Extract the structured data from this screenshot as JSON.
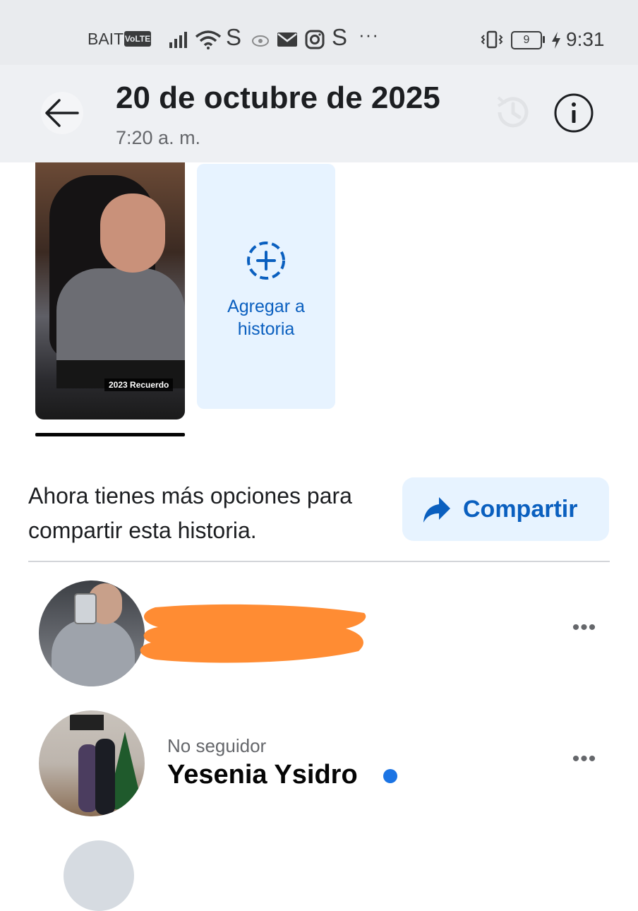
{
  "status_bar": {
    "carrier": "BAIT",
    "volte": "VoLTE",
    "app_icon_s": "S",
    "more": "···",
    "battery_level": "9",
    "time": "9:31",
    "icons": [
      "signal-icon",
      "wifi-icon",
      "s-app-icon",
      "eye-icon",
      "mail-icon",
      "instagram-icon",
      "vibrate-icon",
      "battery-icon",
      "charging-icon"
    ]
  },
  "header": {
    "title": "20 de octubre de 2025",
    "subtitle": "7:20 a. m."
  },
  "stories": {
    "memory_tag": "2023 Recuerdo",
    "add_story_label": "Agregar a historia"
  },
  "share": {
    "text": "Ahora tienes más opciones para compartir esta historia.",
    "button_label": "Compartir"
  },
  "viewers": [
    {
      "status": "",
      "name": ""
    },
    {
      "status": "No seguidor",
      "name": "Yesenia Ysidro"
    }
  ],
  "more_label": "•••",
  "colors": {
    "accent": "#0a5fbf",
    "accent_bg": "#e7f3ff",
    "online": "#1b74e4",
    "redaction": "#ff8c33"
  }
}
